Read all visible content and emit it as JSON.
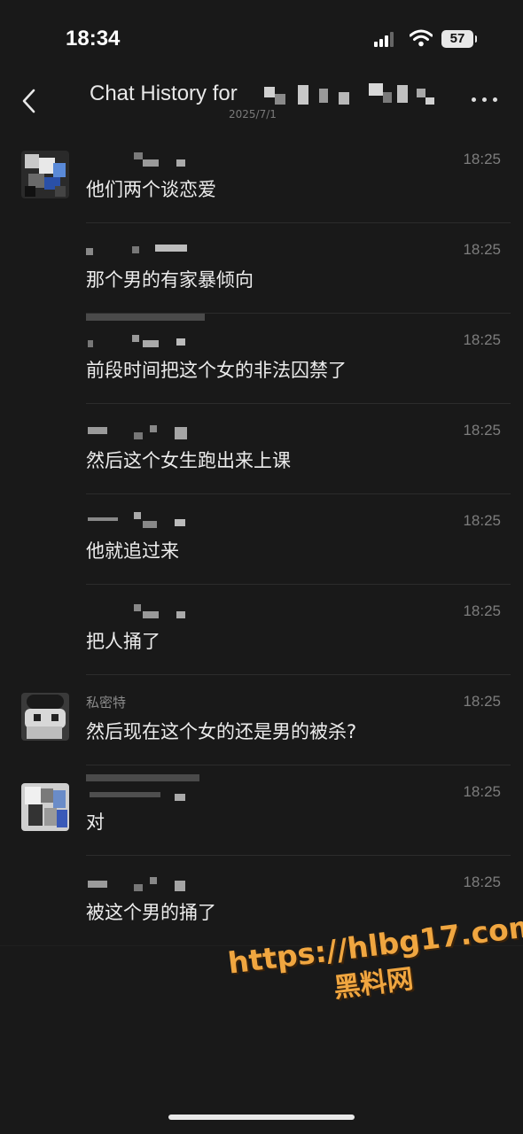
{
  "status_bar": {
    "time": "18:34",
    "battery": "57"
  },
  "header": {
    "title": "Chat History for",
    "subtitle": "2025/7/1"
  },
  "messages": [
    {
      "sender": "",
      "time": "18:25",
      "text": "他们两个谈恋爱",
      "avatar": "a"
    },
    {
      "sender": "",
      "time": "18:25",
      "text": "那个男的有家暴倾向"
    },
    {
      "sender": "",
      "time": "18:25",
      "text": "前段时间把这个女的非法囚禁了"
    },
    {
      "sender": "",
      "time": "18:25",
      "text": "然后这个女生跑出来上课"
    },
    {
      "sender": "",
      "time": "18:25",
      "text": "他就追过来"
    },
    {
      "sender": "",
      "time": "18:25",
      "text": "把人捅了"
    },
    {
      "sender": "私密特",
      "time": "18:25",
      "text": "然后现在这个女的还是男的被杀?",
      "avatar": "b"
    },
    {
      "sender": "",
      "time": "18:25",
      "text": "对",
      "avatar": "c"
    },
    {
      "sender": "",
      "time": "18:25",
      "text": "被这个男的捅了"
    }
  ],
  "watermark": {
    "url": "https://hlbg17.com",
    "name": "黑料网"
  },
  "colors": {
    "background": "#191919",
    "watermark": "#f0a640"
  }
}
